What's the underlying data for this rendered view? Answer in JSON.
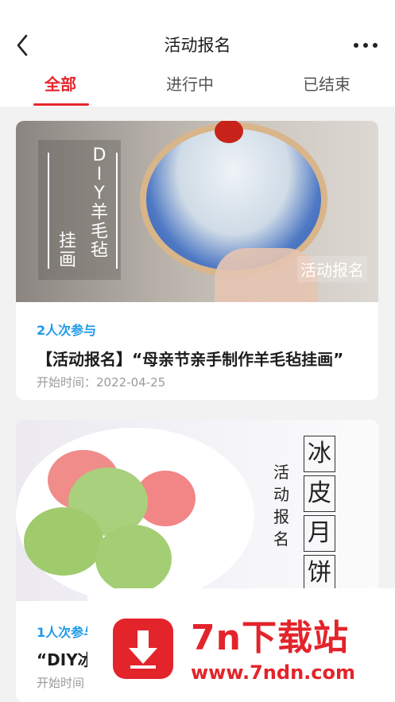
{
  "header": {
    "title": "活动报名",
    "back_icon": "chevron-left-icon",
    "more_icon": "more-dots-icon"
  },
  "tabs": [
    {
      "label": "全部",
      "active": true
    },
    {
      "label": "进行中",
      "active": false
    },
    {
      "label": "已结束",
      "active": false
    }
  ],
  "activities": [
    {
      "banner_text_vertical": [
        "D",
        "I",
        "Y"
      ],
      "banner_text_col1": [
        "羊",
        "毛",
        "毡"
      ],
      "banner_text_col2": [
        "挂",
        "画"
      ],
      "banner_tag": "活动报名",
      "count": "2人次参与",
      "title": "【活动报名】“母亲节亲手制作羊毛毡挂画”",
      "start_time": "开始时间：2022-04-25"
    },
    {
      "banner_text_small": [
        "活",
        "动",
        "报",
        "名"
      ],
      "banner_text_big": [
        "冰",
        "皮",
        "月",
        "饼"
      ],
      "count": "1人次参与",
      "title": "“DIY冰皮月饼”",
      "start_time": "开始时间"
    }
  ],
  "watermark": {
    "title": "7n下载站",
    "url": "www.7ndn.com"
  },
  "colors": {
    "accent": "#e5262c",
    "count": "#1f9ae8"
  }
}
